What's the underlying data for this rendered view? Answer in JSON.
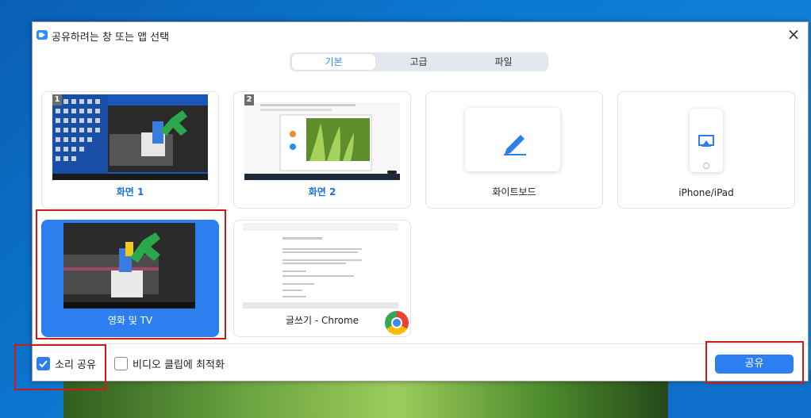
{
  "dialog": {
    "title": "공유하려는 창 또는 앱 선택",
    "close_glyph": "×"
  },
  "tabs": [
    {
      "label": "기본",
      "active": true
    },
    {
      "label": "고급",
      "active": false
    },
    {
      "label": "파일",
      "active": false
    }
  ],
  "sources": [
    {
      "label": "화면 1",
      "badge": "1"
    },
    {
      "label": "화면 2",
      "badge": "2"
    },
    {
      "label": "화이트보드"
    },
    {
      "label": "iPhone/iPad"
    },
    {
      "label": "영화 및 TV",
      "selected": true
    },
    {
      "label": "글쓰기 - Chrome"
    }
  ],
  "options": {
    "share_sound": {
      "label": "소리 공유",
      "checked": true
    },
    "optimize_video": {
      "label": "비디오 클립에 최적화",
      "checked": false
    }
  },
  "share_button": "공유",
  "colors": {
    "accent": "#2d7ff0",
    "highlight": "#d01a1a"
  }
}
